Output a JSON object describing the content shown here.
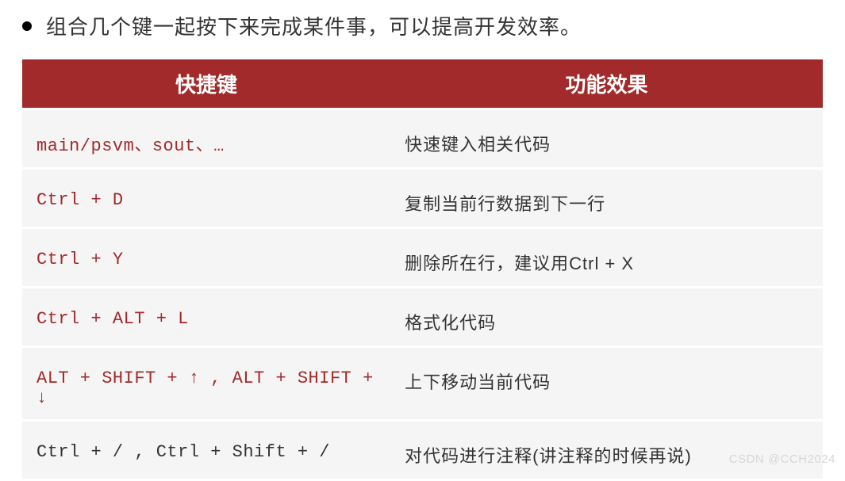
{
  "bullet_text": "组合几个键一起按下来完成某件事，可以提高开发效率。",
  "headers": {
    "key": "快捷键",
    "func": "功能效果"
  },
  "rows": [
    {
      "key": "main/psvm、sout、…",
      "func": "快速键入相关代码",
      "red": true
    },
    {
      "key": "Ctrl + D",
      "func": "复制当前行数据到下一行",
      "red": true
    },
    {
      "key": "Ctrl + Y",
      "func": "删除所在行，建议用Ctrl + X",
      "red": true
    },
    {
      "key": "Ctrl + ALT + L",
      "func": "格式化代码",
      "red": true
    },
    {
      "key": "ALT + SHIFT + ↑ , ALT + SHIFT + ↓",
      "func": "上下移动当前代码",
      "red": true
    },
    {
      "key": "Ctrl + / , Ctrl + Shift + /",
      "func": "对代码进行注释(讲注释的时候再说)",
      "red": false
    }
  ],
  "watermark": "CSDN @CCH2024"
}
